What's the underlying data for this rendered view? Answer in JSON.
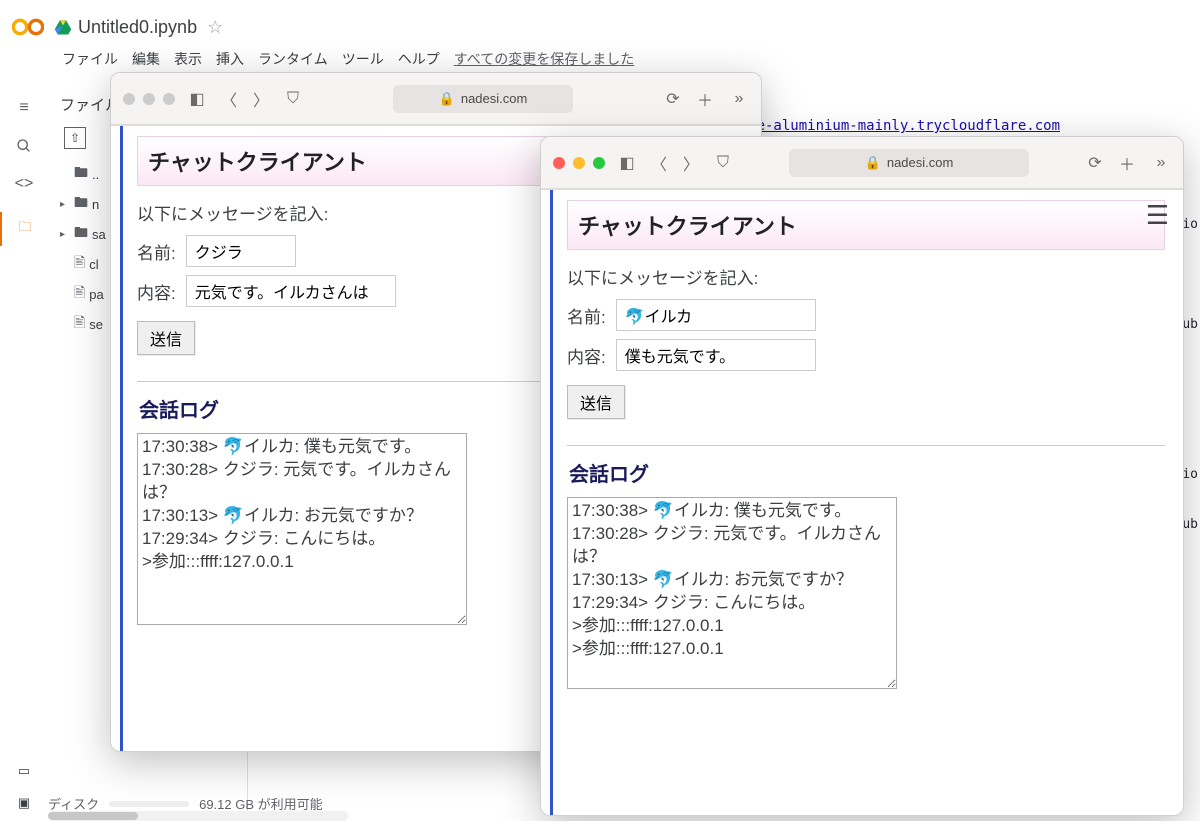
{
  "colab": {
    "doc_title": "Untitled0.ipynb",
    "menus": [
      "ファイル",
      "編集",
      "表示",
      "挿入",
      "ランタイム",
      "ツール",
      "ヘルプ"
    ],
    "save_msg": "すべての変更を保存しました",
    "file_panel_title": "ファイル",
    "tree": {
      "parent": "..",
      "folders": [
        "n",
        "sa"
      ],
      "files": [
        "cl",
        "pa",
        "se"
      ]
    },
    "partial_url": "e-aluminium-mainly.trycloudflare.com",
    "partial_code": "io\n\nub\n\n\nio\nub\n",
    "disk_label": "ディスク",
    "disk_text": "69.12 GB が利用可能"
  },
  "safari1": {
    "url": "nadesi.com",
    "chat_title": "チャットクライアント",
    "instructions": "以下にメッセージを記入:",
    "name_label": "名前:",
    "name_value": "クジラ",
    "content_label": "内容:",
    "content_value": "元気です。イルカさんは",
    "send_label": "送信",
    "log_title": "会話ログ",
    "log_text": "17:30:38> 🐬イルカ: 僕も元気です。\n17:30:28> クジラ: 元気です。イルカさんは？\n17:30:13> 🐬イルカ: お元気ですか？\n17:29:34> クジラ: こんにちは。\n>参加:::ffff:127.0.0.1"
  },
  "safari2": {
    "url": "nadesi.com",
    "chat_title": "チャットクライアント",
    "instructions": "以下にメッセージを記入:",
    "name_label": "名前:",
    "name_value": "🐬イルカ",
    "content_label": "内容:",
    "content_value": "僕も元気です。",
    "send_label": "送信",
    "log_title": "会話ログ",
    "log_text": "17:30:38> 🐬イルカ: 僕も元気です。\n17:30:28> クジラ: 元気です。イルカさんは？\n17:30:13> 🐬イルカ: お元気ですか？\n17:29:34> クジラ: こんにちは。\n>参加:::ffff:127.0.0.1\n>参加:::ffff:127.0.0.1"
  }
}
